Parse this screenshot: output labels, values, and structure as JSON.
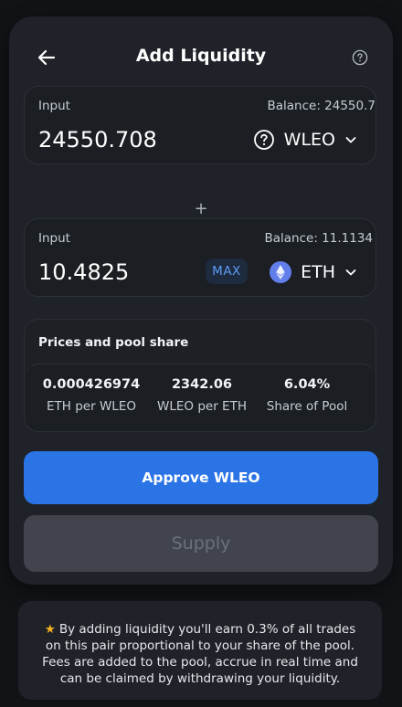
{
  "header": {
    "title": "Add Liquidity"
  },
  "input_a": {
    "label": "Input",
    "balance": "Balance: 24550.7",
    "value": "24550.708",
    "token": "WLEO"
  },
  "plus_sign": "+",
  "input_b": {
    "label": "Input",
    "balance": "Balance: 11.1134",
    "value": "10.4825",
    "token": "ETH",
    "max_label": "MAX"
  },
  "prices": {
    "title": "Prices and pool share",
    "stats": [
      {
        "value": "0.000426974",
        "label": "ETH per WLEO"
      },
      {
        "value": "2342.06",
        "label": "WLEO per ETH"
      },
      {
        "value": "6.04%",
        "label": "Share of Pool"
      }
    ]
  },
  "buttons": {
    "approve": "Approve WLEO",
    "supply": "Supply"
  },
  "info": {
    "star": "★",
    "text": "By adding liquidity you'll earn 0.3% of all trades on this pair proportional to your share of the pool. Fees are added to the pool, accrue in real time and can be claimed by withdrawing your liquidity."
  },
  "colors": {
    "accent": "#2a74e6",
    "panel": "#1f2228",
    "background": "#111317",
    "max_text": "#5b9cf7",
    "star": "#f2b01e"
  },
  "icons": {
    "back": "arrow-left-icon",
    "help": "question-circle-icon",
    "wleo": "question-circle-icon",
    "eth": "ethereum-logo-icon",
    "dropdown": "chevron-down-icon"
  }
}
